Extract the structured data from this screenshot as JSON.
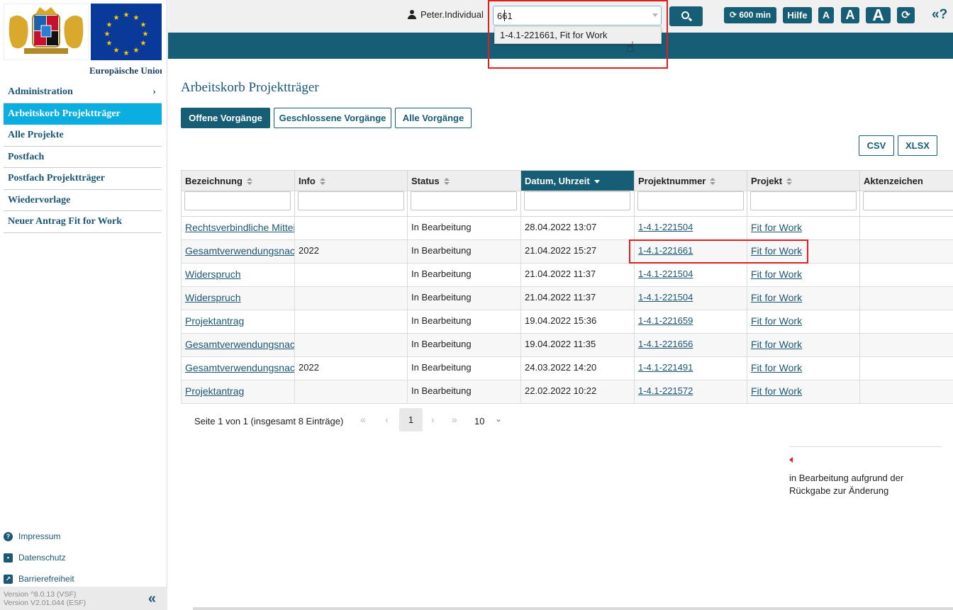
{
  "sidebar": {
    "eu_label": "Europäische Union",
    "nav": [
      {
        "label": "Administration"
      },
      {
        "label": "Arbeitskorb Projektträger"
      },
      {
        "label": "Alle Projekte"
      },
      {
        "label": "Postfach"
      },
      {
        "label": "Postfach Projektträger"
      },
      {
        "label": "Wiedervorlage"
      },
      {
        "label": "Neuer Antrag Fit for Work"
      }
    ],
    "footer_links": [
      {
        "label": "Impressum",
        "icon": "question-icon"
      },
      {
        "label": "Datenschutz",
        "icon": "id-card-icon"
      },
      {
        "label": "Barrierefreiheit",
        "icon": "external-link-icon"
      }
    ],
    "version_1": "Version ^8.0.13 (VSF)",
    "version_2": "Version V2.01.044 (ESF)",
    "collapse_label": "«"
  },
  "topbar": {
    "user": "Peter.Individual",
    "search_value": "661",
    "suggestion": "1-4.1-221661, Fit for Work",
    "session_label": "600 min",
    "help_label": "Hilfe",
    "font_small": "A",
    "font_medium": "A",
    "font_large": "A",
    "reload_label": "⟳",
    "expand_label": "«?"
  },
  "main": {
    "title": "Arbeitskorb Projektträger",
    "tabs": [
      "Offene Vorgänge",
      "Geschlossene Vorgänge",
      "Alle Vorgänge"
    ],
    "export": {
      "csv": "CSV",
      "xlsx": "XLSX"
    },
    "columns": [
      "Bezeichnung",
      "Info",
      "Status",
      "Datum, Uhrzeit",
      "Projektnummer",
      "Projekt",
      "Aktenzeichen"
    ],
    "rows": [
      {
        "bezeichnung": "Rechtsverbindliche Mitteilung",
        "info": "",
        "status": "In Bearbeitung",
        "datum": "28.04.2022 13:07",
        "projektnummer": "1-4.1-221504",
        "projekt": "Fit for Work",
        "aktenzeichen": ""
      },
      {
        "bezeichnung": "Gesamtverwendungsnachweis",
        "info": "2022",
        "status": "In Bearbeitung",
        "datum": "21.04.2022 15:27",
        "projektnummer": "1-4.1-221661",
        "projekt": "Fit for Work",
        "aktenzeichen": ""
      },
      {
        "bezeichnung": "Widerspruch",
        "info": "",
        "status": "In Bearbeitung",
        "datum": "21.04.2022 11:37",
        "projektnummer": "1-4.1-221504",
        "projekt": "Fit for Work",
        "aktenzeichen": ""
      },
      {
        "bezeichnung": "Widerspruch",
        "info": "",
        "status": "In Bearbeitung",
        "datum": "21.04.2022 11:37",
        "projektnummer": "1-4.1-221504",
        "projekt": "Fit for Work",
        "aktenzeichen": ""
      },
      {
        "bezeichnung": "Projektantrag",
        "info": "",
        "status": "In Bearbeitung",
        "datum": "19.04.2022 15:36",
        "projektnummer": "1-4.1-221659",
        "projekt": "Fit for Work",
        "aktenzeichen": ""
      },
      {
        "bezeichnung": "Gesamtverwendungsnachweis",
        "info": "",
        "status": "In Bearbeitung",
        "datum": "19.04.2022 11:35",
        "projektnummer": "1-4.1-221656",
        "projekt": "Fit for Work",
        "aktenzeichen": ""
      },
      {
        "bezeichnung": "Gesamtverwendungsnachweis",
        "info": "2022",
        "status": "In Bearbeitung",
        "datum": "24.03.2022 14:20",
        "projektnummer": "1-4.1-221491",
        "projekt": "Fit for Work",
        "aktenzeichen": ""
      },
      {
        "bezeichnung": "Projektantrag",
        "info": "",
        "status": "In Bearbeitung",
        "datum": "22.02.2022 10:22",
        "projektnummer": "1-4.1-221572",
        "projekt": "Fit for Work",
        "aktenzeichen": ""
      }
    ],
    "pager": {
      "info": "Seite 1 von 1 (insgesamt 8 Einträge)",
      "first": "«",
      "prev": "‹",
      "current": "1",
      "next": "›",
      "last": "»",
      "page_size": "10"
    },
    "legend_text": "in Bearbeitung aufgrund der Rückgabe zur Änderung"
  },
  "colors": {
    "brand": "#155e75",
    "active_nav": "#0aaee0",
    "highlight": "#e02020"
  }
}
